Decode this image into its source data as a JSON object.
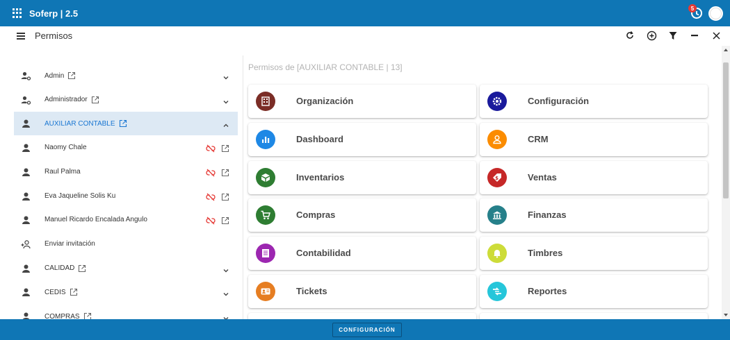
{
  "app": {
    "title": "Soferp | 2.5",
    "notification_count": "5"
  },
  "header": {
    "page_title": "Permisos"
  },
  "left": {
    "groups": [
      {
        "label": "Admin",
        "external": true,
        "chevron": "down",
        "icon": "user-gear-icon"
      },
      {
        "label": "Administrador",
        "external": true,
        "chevron": "down",
        "icon": "user-gear-icon"
      },
      {
        "label": "AUXILIAR CONTABLE",
        "external": true,
        "chevron": "up",
        "icon": "user-icon",
        "active": true
      },
      {
        "label": "Naomy Chale",
        "member": true,
        "icon": "user-icon"
      },
      {
        "label": "Raul Palma",
        "member": true,
        "icon": "user-icon"
      },
      {
        "label": "Eva Jaqueline Solis Ku",
        "member": true,
        "icon": "user-icon"
      },
      {
        "label": "Manuel Ricardo Encalada Angulo",
        "member": true,
        "icon": "user-icon"
      },
      {
        "label": "Enviar invitación",
        "icon": "invite-user-icon"
      },
      {
        "label": "CALIDAD",
        "external": true,
        "chevron": "down",
        "icon": "user-icon"
      },
      {
        "label": "CEDIS",
        "external": true,
        "chevron": "down",
        "icon": "user-icon"
      },
      {
        "label": "COMPRAS",
        "external": true,
        "chevron": "down",
        "icon": "user-icon"
      }
    ]
  },
  "right": {
    "title": "Permisos de [AUXILIAR CONTABLE | 13]",
    "modules": [
      {
        "name": "Organización",
        "color": "#7b2d26",
        "icon": "building-icon"
      },
      {
        "name": "Configuración",
        "color": "#1a1a9c",
        "icon": "gear-icon"
      },
      {
        "name": "Dashboard",
        "color": "#1e88e5",
        "icon": "bar-chart-icon"
      },
      {
        "name": "CRM",
        "color": "#fb8c00",
        "icon": "person-icon"
      },
      {
        "name": "Inventarios",
        "color": "#2e7d32",
        "icon": "box-icon"
      },
      {
        "name": "Ventas",
        "color": "#c62828",
        "icon": "price-tag-icon"
      },
      {
        "name": "Compras",
        "color": "#2e7d32",
        "icon": "cart-icon"
      },
      {
        "name": "Finanzas",
        "color": "#26808a",
        "icon": "bank-icon"
      },
      {
        "name": "Contabilidad",
        "color": "#9c27b0",
        "icon": "ledger-icon"
      },
      {
        "name": "Timbres",
        "color": "#cddc39",
        "icon": "bell-icon"
      },
      {
        "name": "Tickets",
        "color": "#e67e22",
        "icon": "ticket-icon"
      },
      {
        "name": "Reportes",
        "color": "#26c6da",
        "icon": "report-icon"
      }
    ]
  },
  "footer": {
    "button_label": "CONFIGURACIÓN"
  }
}
